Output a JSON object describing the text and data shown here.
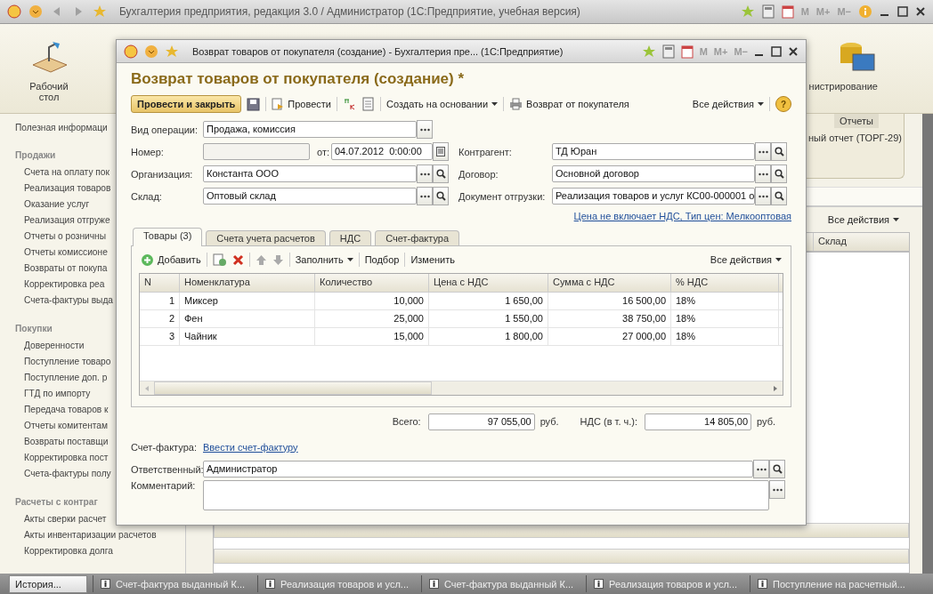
{
  "app": {
    "title": "Бухгалтерия предприятия, редакция 3.0 / Администратор  (1С:Предприятие, учебная версия)",
    "memory_buttons": [
      "M",
      "M+",
      "M−"
    ]
  },
  "sections": [
    {
      "label": "Рабочий стол",
      "kind": "desk"
    },
    {
      "label": "нистрирование",
      "kind": "admin"
    }
  ],
  "sidebar": {
    "top_link": "Полезная информаци",
    "groups": [
      {
        "title": "Продажи",
        "items": [
          "Счета на оплату пок",
          "Реализация товаров",
          "Оказание услуг",
          "Реализация отгруже",
          "Отчеты о розничны",
          "Отчеты комиссионе",
          "Возвраты от покупа",
          "Корректировка реа",
          "Счета-фактуры выда"
        ]
      },
      {
        "title": "Покупки",
        "items": [
          "Доверенности",
          "Поступление товаро",
          "Поступление доп. р",
          "ГТД по импорту",
          "Передача товаров к",
          "Отчеты комитентам",
          "Возвраты поставщи",
          "Корректировка пост",
          "Счета-фактуры полу"
        ]
      },
      {
        "title": "Расчеты с контраг",
        "items": [
          "Акты сверки расчет",
          "Акты инвентаризации расчетов",
          "Корректировка долга"
        ]
      }
    ]
  },
  "reports_panel": {
    "title": "Отчеты",
    "items": [
      "ный отчет (ТОРГ-29)"
    ]
  },
  "list": {
    "all_actions": "Все действия",
    "columns": [
      "Склад"
    ]
  },
  "dialog": {
    "title": "Возврат товаров от покупателя (создание) - Бухгалтерия пре...  (1С:Предприятие)",
    "memory_buttons": [
      "M",
      "M+",
      "M−"
    ],
    "heading": "Возврат товаров от покупателя (создание) *",
    "toolbar": {
      "primary": "Провести и закрыть",
      "post": "Провести",
      "create_based": "Создать на основании",
      "print": "Возврат от покупателя",
      "all_actions": "Все действия",
      "help": "?"
    },
    "operation": {
      "label": "Вид операции:",
      "value": "Продажа, комиссия",
      "kind": "open"
    },
    "number": {
      "label": "Номер:",
      "date_label": "от:",
      "date": "04.07.2012  0:00:00"
    },
    "left_fields": [
      {
        "label": "Организация:",
        "value": "Константа ООО",
        "kind": "select"
      },
      {
        "label": "Склад:",
        "value": "Оптовый склад",
        "kind": "select"
      }
    ],
    "right_fields": [
      {
        "label": "Контрагент:",
        "value": "ТД Юран",
        "kind": "select"
      },
      {
        "label": "Договор:",
        "value": "Основной договор",
        "kind": "select"
      },
      {
        "label": "Документ отгрузки:",
        "value": "Реализация товаров и услуг КС00-000001 о",
        "kind": "select"
      }
    ],
    "price_link": "Цена не включает НДС, Тип цен: Мелкооптовая",
    "tabs": [
      {
        "label": "Товары (3)",
        "selected": true
      },
      {
        "label": "Счета учета расчетов",
        "selected": false
      },
      {
        "label": "НДС",
        "selected": false
      },
      {
        "label": "Счет-фактура",
        "selected": false
      }
    ],
    "table_toolbar": {
      "add": "Добавить",
      "fill": "Заполнить",
      "pick": "Подбор",
      "edit": "Изменить",
      "all_actions": "Все действия"
    },
    "table": {
      "columns": [
        "N",
        "Номенклатура",
        "Количество",
        "Цена с НДС",
        "Сумма с НДС",
        "% НДС"
      ],
      "rows": [
        [
          "1",
          "Миксер",
          "10,000",
          "1 650,00",
          "16 500,00",
          "18%"
        ],
        [
          "2",
          "Фен",
          "25,000",
          "1 550,00",
          "38 750,00",
          "18%"
        ],
        [
          "3",
          "Чайник",
          "15,000",
          "1 800,00",
          "27 000,00",
          "18%"
        ]
      ]
    },
    "totals": {
      "total_label": "Всего:",
      "total": "97 055,00",
      "total_unit": "руб.",
      "vat_label": "НДС (в т. ч.):",
      "vat": "14 805,00",
      "vat_unit": "руб."
    },
    "invoice": {
      "label": "Счет-фактура:",
      "link": "Ввести счет-фактуру"
    },
    "responsible": {
      "label": "Ответственный:",
      "value": "Администратор",
      "kind": "select"
    },
    "comment": {
      "label": "Комментарий:"
    }
  },
  "taskbar": {
    "history": "История...",
    "tabs": [
      "Счет-фактура выданный К...",
      "Реализация товаров и усл...",
      "Счет-фактура выданный К...",
      "Реализация товаров и усл...",
      "Поступление на расчетный..."
    ]
  }
}
